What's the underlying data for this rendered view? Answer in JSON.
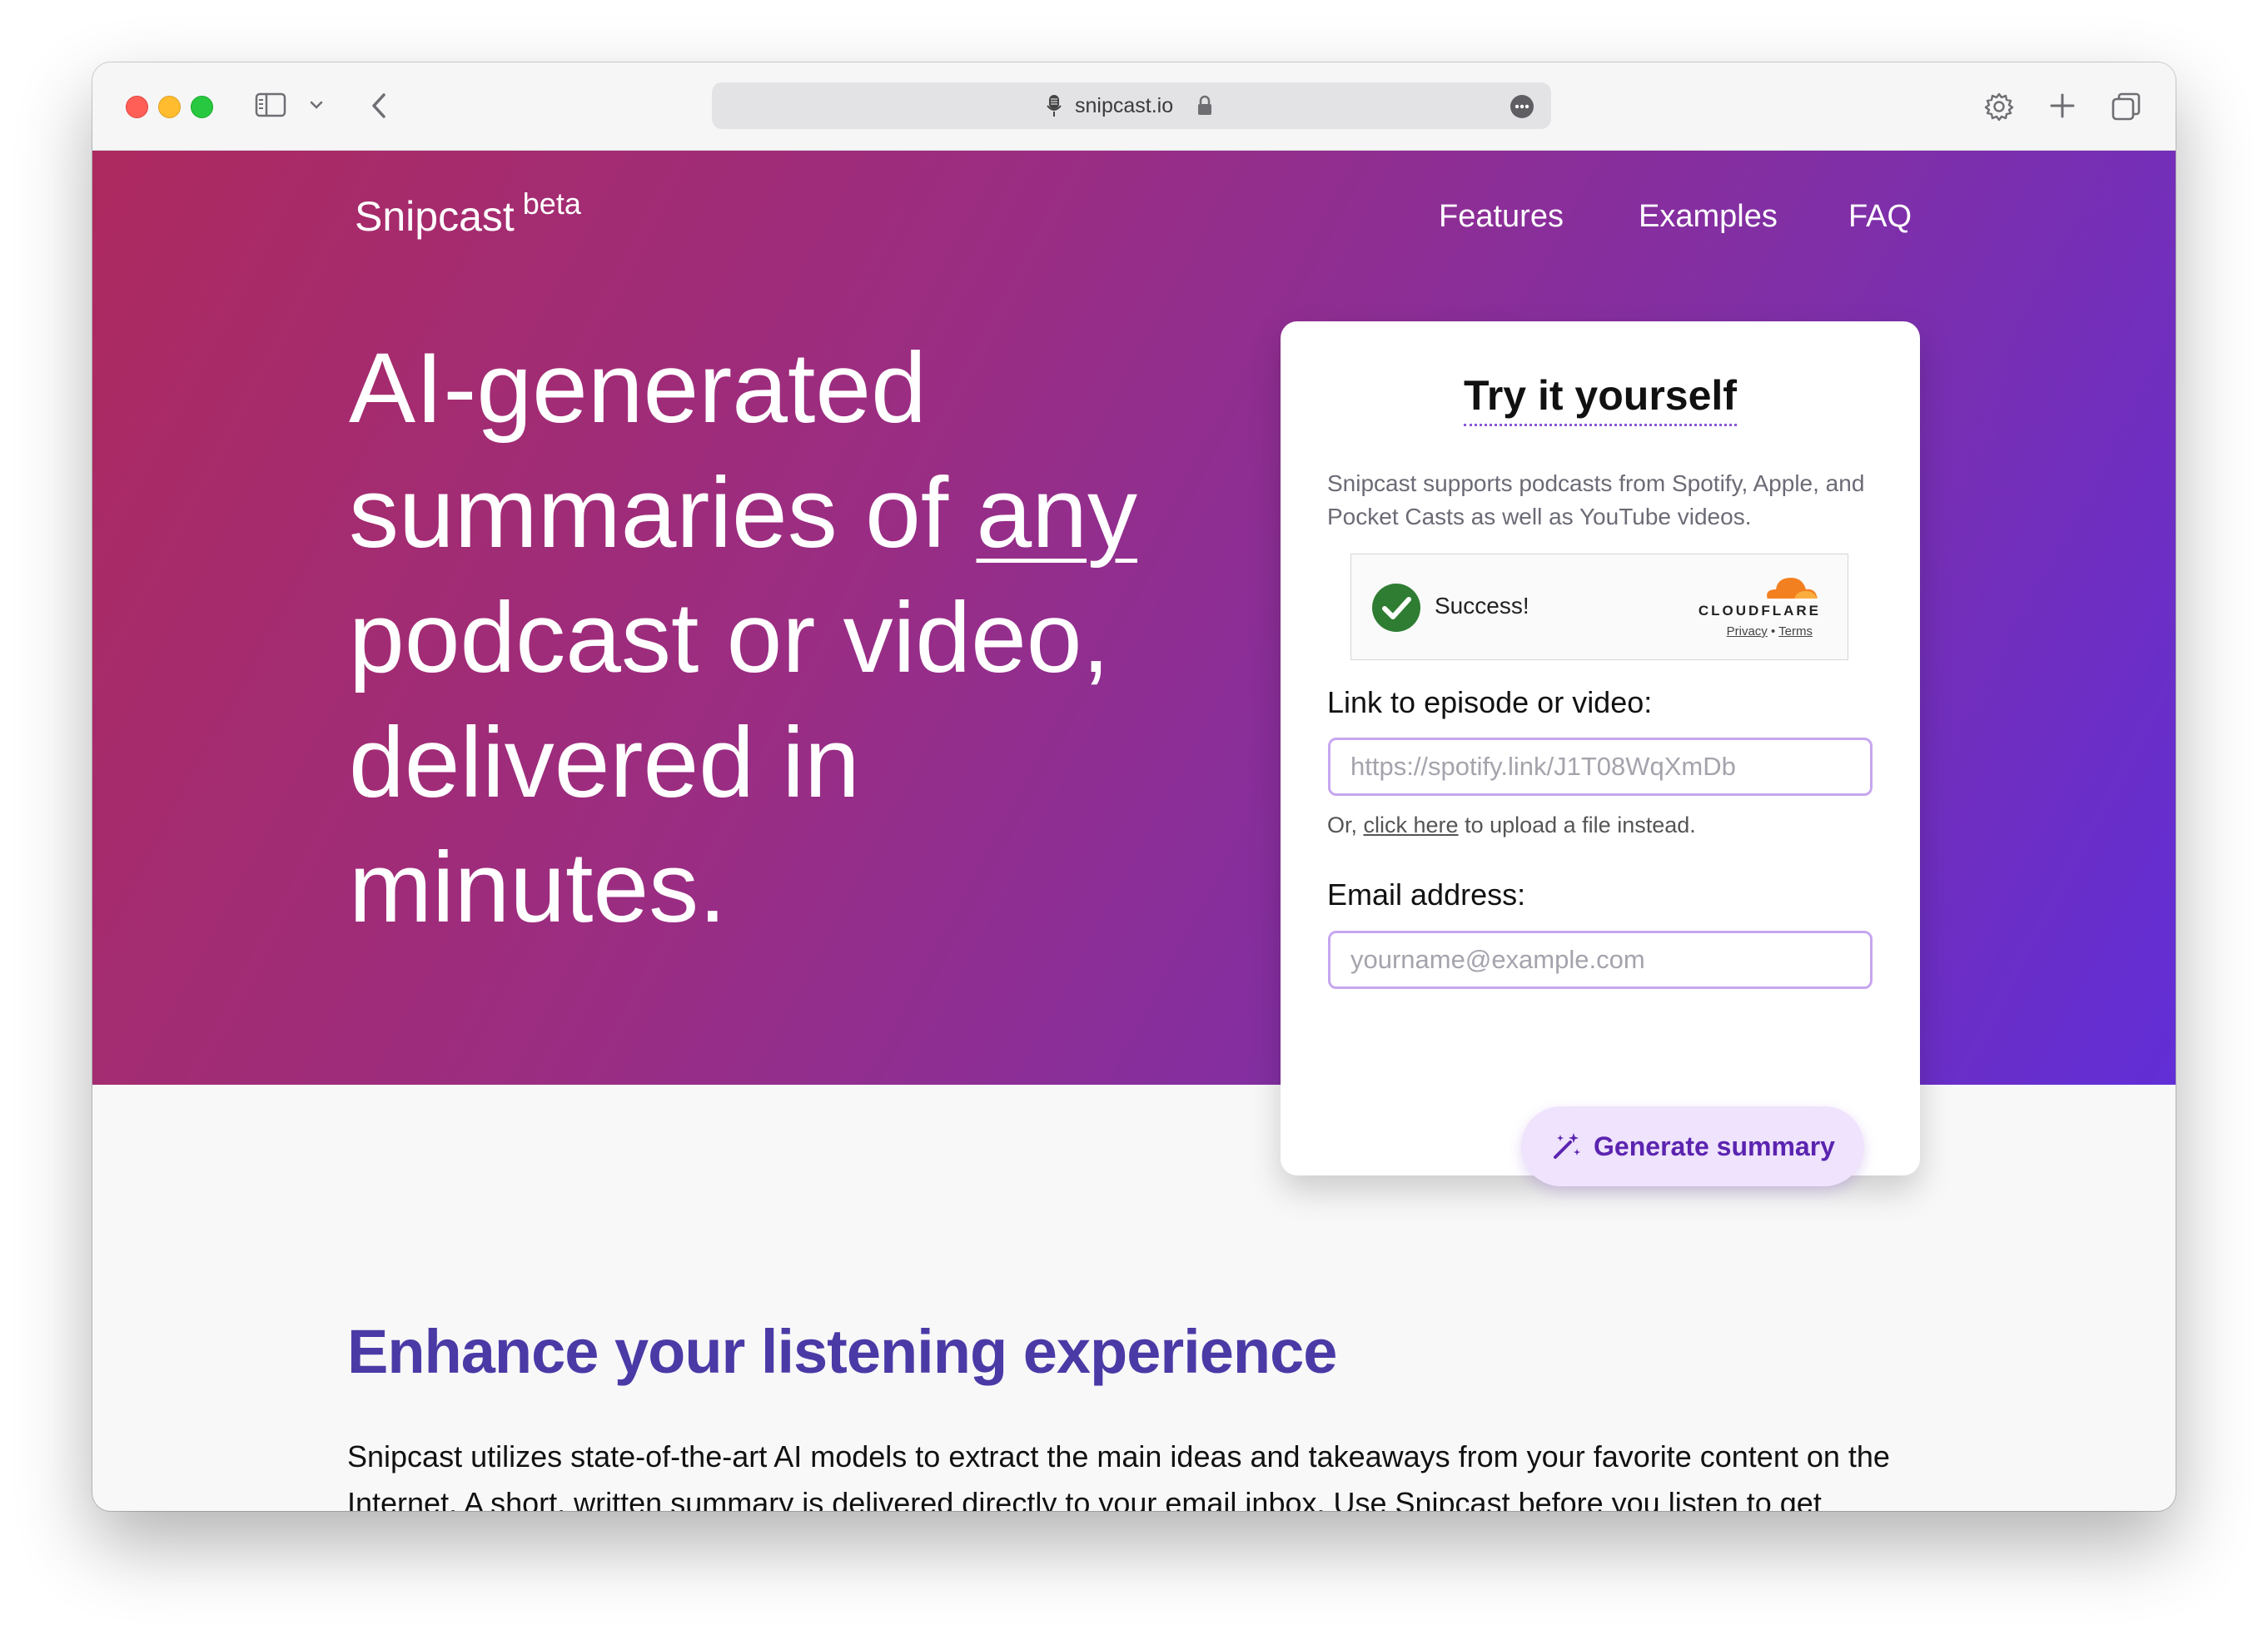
{
  "browser": {
    "url": "snipcast.io",
    "icons": {
      "sidebar": "sidebar-icon",
      "back": "chevron-left-icon",
      "site": "microphone-icon",
      "lock": "lock-icon",
      "more": "ellipsis-icon",
      "settings": "gear-icon",
      "new_tab": "plus-icon",
      "tabs": "tab-overview-icon"
    }
  },
  "header": {
    "brand": "Snipcast",
    "badge": "beta",
    "nav": [
      "Features",
      "Examples",
      "FAQ"
    ]
  },
  "hero": {
    "headline_lines": [
      "AI-generated",
      "summaries of ",
      "any",
      "podcast or video,",
      "delivered in",
      "minutes."
    ]
  },
  "card": {
    "title": "Try it yourself",
    "description": "Snipcast supports podcasts from Spotify, Apple, and Pocket Casts as well as YouTube videos.",
    "captcha": {
      "status": "Success!",
      "provider": "CLOUDFLARE",
      "privacy": "Privacy",
      "separator": "•",
      "terms": "Terms"
    },
    "link_label": "Link to episode or video:",
    "link_placeholder": "https://spotify.link/J1T08WqXmDb",
    "upload_prefix": "Or, ",
    "upload_link": "click here",
    "upload_suffix": " to upload a file instead.",
    "email_label": "Email address:",
    "email_placeholder": "yourname@example.com",
    "submit_label": "Generate summary"
  },
  "content": {
    "title": "Enhance your listening experience",
    "text": "Snipcast utilizes state-of-the-art AI models to extract the main ideas and takeaways from your favorite content on the Internet. A short, written summary is delivered directly to your email inbox. Use Snipcast before you listen to get"
  },
  "colors": {
    "gradient_start": "#ad2a5f",
    "gradient_end": "#612ed6",
    "accent": "#5b24b0",
    "input_border": "#c7a6f0",
    "section_title": "#4a3aa6"
  }
}
